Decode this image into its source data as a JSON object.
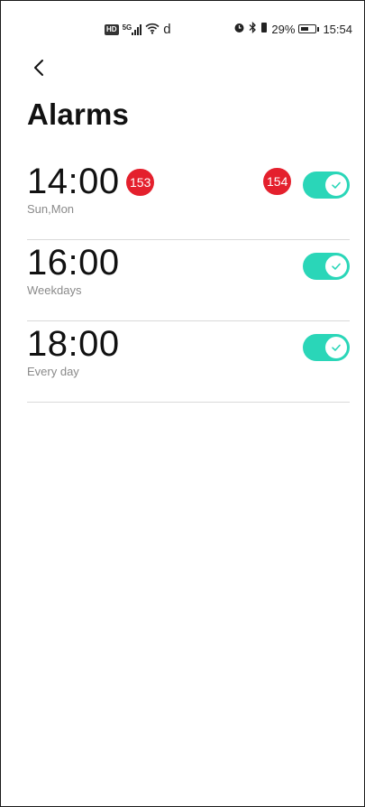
{
  "status_bar": {
    "network_label": "5G",
    "hd_label": "HD",
    "extra_label": "d",
    "battery_percent": "29%",
    "time": "15:54",
    "icons": [
      "hd-icon",
      "signal-icon",
      "wifi-icon",
      "alarm-clock-icon",
      "bluetooth-icon",
      "vibrate-icon",
      "battery-icon"
    ]
  },
  "header": {
    "back_icon": "chevron-left-icon",
    "title": "Alarms"
  },
  "alarms": [
    {
      "time": "14:00",
      "repeat": "Sun,Mon",
      "enabled": true
    },
    {
      "time": "16:00",
      "repeat": "Weekdays",
      "enabled": true
    },
    {
      "time": "18:00",
      "repeat": "Every day",
      "enabled": true
    }
  ],
  "badges": {
    "first": "153",
    "second": "154"
  },
  "colors": {
    "toggle_on": "#2ad6b8",
    "badge": "#e4202d",
    "subtext": "#8a8a8a"
  }
}
